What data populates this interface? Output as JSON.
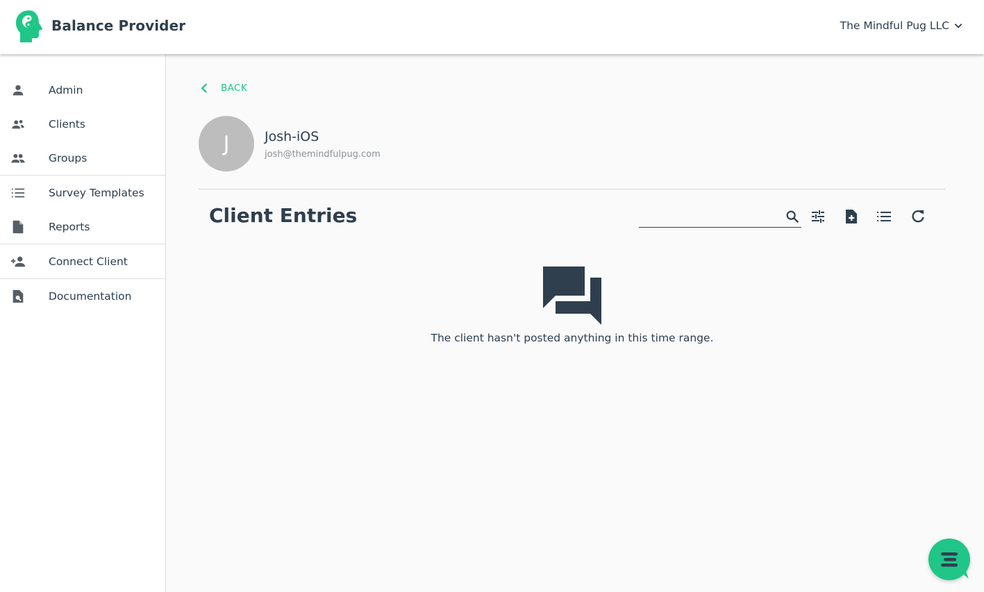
{
  "header": {
    "brand": "Balance Provider",
    "organization": "The Mindful Pug LLC"
  },
  "sidebar": {
    "items": [
      {
        "label": "Admin",
        "icon": "person-icon"
      },
      {
        "label": "Clients",
        "icon": "clients-icon"
      },
      {
        "label": "Groups",
        "icon": "groups-icon"
      },
      {
        "label": "Survey Templates",
        "icon": "list-numbered-icon"
      },
      {
        "label": "Reports",
        "icon": "document-icon"
      },
      {
        "label": "Connect Client",
        "icon": "person-add-icon"
      },
      {
        "label": "Documentation",
        "icon": "document-search-icon"
      }
    ]
  },
  "main": {
    "back_label": "BACK",
    "client": {
      "initial": "J",
      "name": "Josh-iOS",
      "email": "josh@themindfulpug.com"
    },
    "section_title": "Client Entries",
    "search": {
      "value": "",
      "placeholder": ""
    },
    "empty_message": "The client hasn't posted anything in this time range."
  },
  "colors": {
    "accent": "#1fc688",
    "text_dark": "#2f3f4e",
    "avatar_bg": "#bdbdbd"
  }
}
